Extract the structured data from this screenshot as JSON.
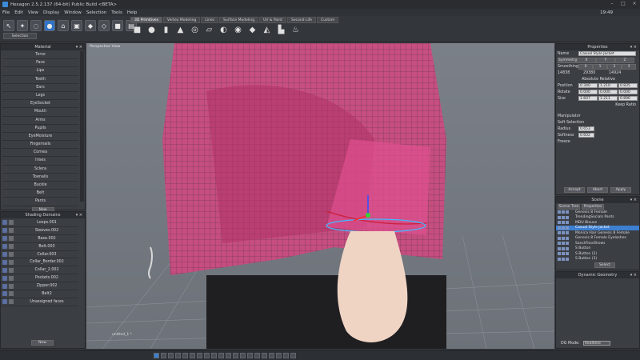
{
  "app": {
    "title": "Hexagon 2.5.2.137 (64-bit) Public Build <BETA>",
    "clock": "19:49"
  },
  "menu": [
    "File",
    "Edit",
    "View",
    "Display",
    "Window",
    "Selection",
    "Tools",
    "Help"
  ],
  "tabs": [
    "3D Primitives",
    "Vertex Modeling",
    "Lines",
    "Surface Modeling",
    "UV & Paint",
    "Second Life",
    "Custom"
  ],
  "toolbar": {
    "selection_label": "Selection",
    "small_labels": [
      "UVG",
      "MDLU",
      "MAG",
      "MTR",
      "MRG",
      "WFM",
      "GMMA"
    ]
  },
  "materials": {
    "title": "Material",
    "items": [
      "Torso",
      "Face",
      "Lips",
      "Teeth",
      "Ears",
      "Legs",
      "EyeSocket",
      "Mouth",
      "Arms",
      "Pupils",
      "EyeMoisture",
      "Fingernails",
      "Cornea",
      "Irises",
      "Sclera",
      "Toenails",
      "Buckle",
      "Belt",
      "Pants"
    ],
    "new_label": "New"
  },
  "shading": {
    "title": "Shading Domains",
    "items": [
      "Loops.001",
      "Sleeves.002",
      "Base.002",
      "Belt.003",
      "Collar.003",
      "Collar_Border.002",
      "Collar_2.002",
      "Pockets.002",
      "Zipper.002",
      "Belt2",
      "Unassigned faces"
    ],
    "new_label": "New"
  },
  "viewport": {
    "label": "Perspective View",
    "object_label": "unttled_1 *"
  },
  "properties": {
    "title": "Properties",
    "name_label": "Name",
    "name_value": "Casual Style Jacket",
    "symmetry_label": "Symmetry",
    "sym_buttons": [
      "X",
      "Y",
      "Z"
    ],
    "smoothing_label": "Smoothing",
    "smooth_buttons": [
      "0",
      "1",
      "2",
      "3"
    ],
    "stats": [
      "14838",
      "29380",
      "14924"
    ],
    "absolute_label": "Absolute",
    "relative_label": "Relative",
    "position_label": "Position",
    "position": [
      "0.340",
      "1.210",
      "0.835"
    ],
    "rotate_label": "Rotate",
    "rotate": [
      "0.000",
      "0.000",
      "0.000"
    ],
    "size_label": "Size",
    "size": [
      "1.607",
      "1.211",
      "0.896"
    ],
    "keep_ratio": "Keep Ratio",
    "manipulator": "Manipulator",
    "soft_selection": "Soft Selection",
    "radius_label": "Radius",
    "radius": "0.653",
    "softness_label": "Softness",
    "softness": "0.602",
    "freeze_label": "Freeze",
    "accept": "Accept",
    "abort": "Abort",
    "apply": "Apply"
  },
  "scene": {
    "title": "Scene",
    "tabs": [
      "Scene Tree",
      "Properties"
    ],
    "items": [
      "Genesis 8 Female",
      "TrendingSocials Pants",
      "MDU Blouse",
      "Casual Style Jacket",
      "Monica Hair Genesis 8 Female",
      "Genesis 8 Female Eyelashes",
      "SanctFloorBrows",
      "S Button",
      "S Button (2)",
      "S Button (3)",
      "S Button (4)"
    ],
    "selected": 3,
    "select_label": "Select"
  },
  "dynamic": {
    "title": "Dynamic Geometry",
    "dg_label": "DG Mode:",
    "dg_value": "Realtime"
  }
}
